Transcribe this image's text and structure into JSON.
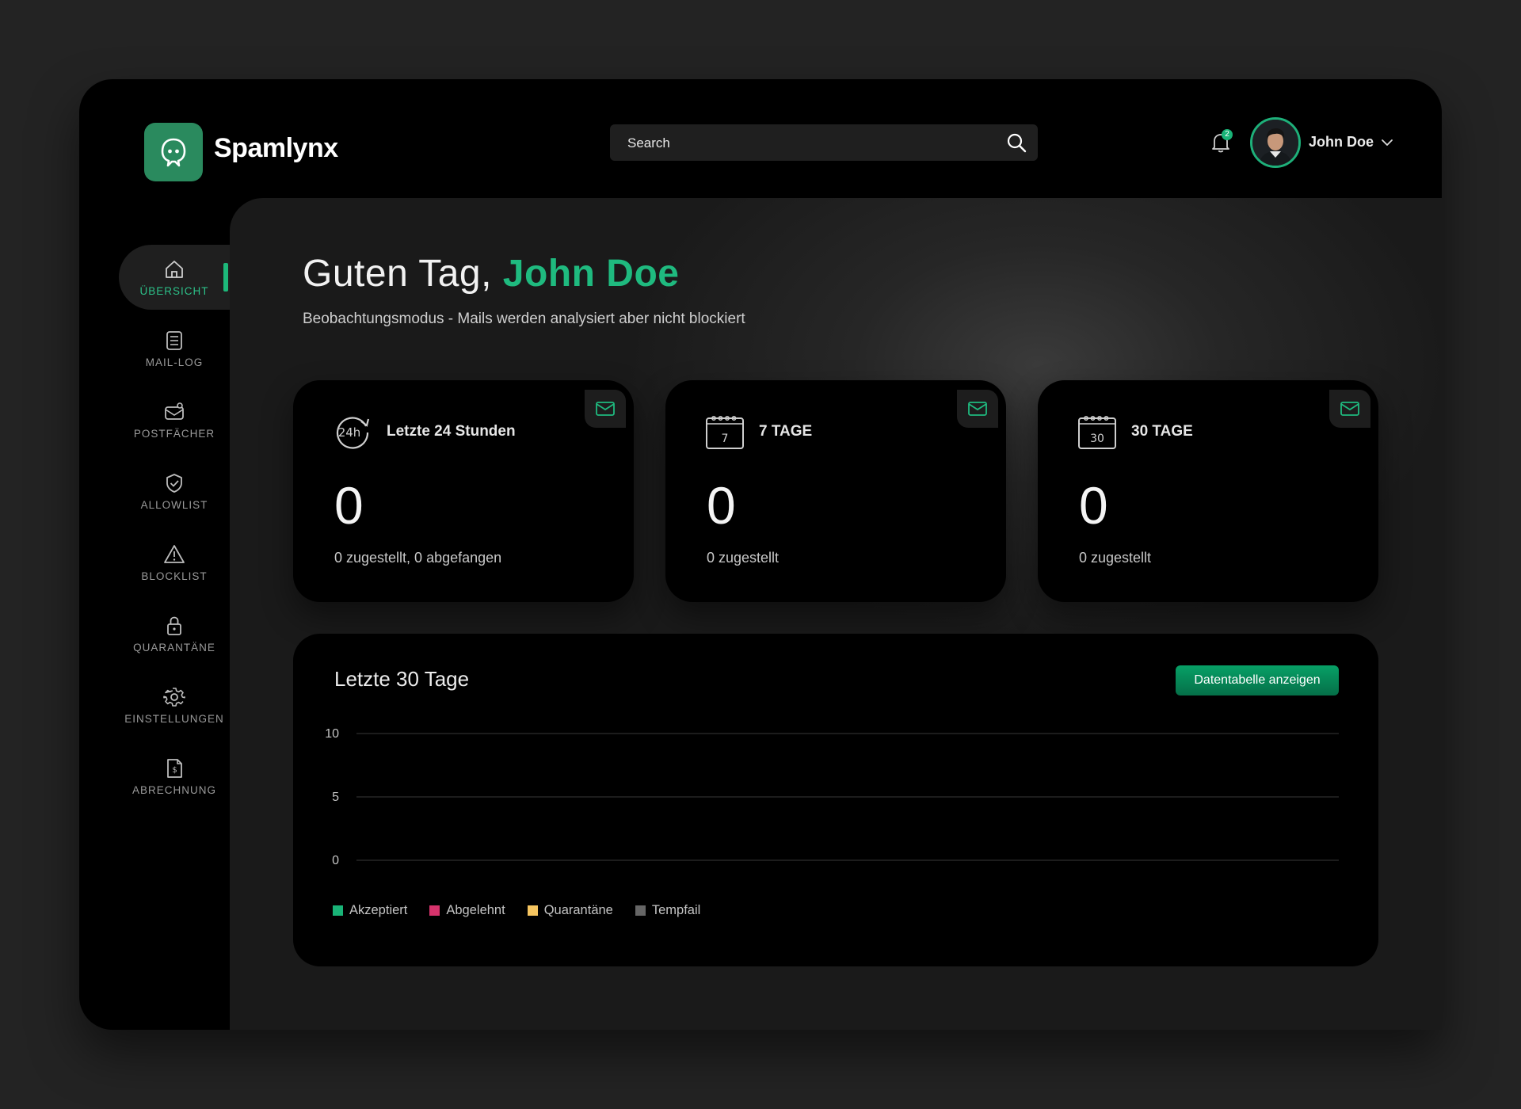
{
  "app": {
    "brand": "Spamlynx"
  },
  "header": {
    "search_placeholder": "Search",
    "notification_count": "2",
    "user_name": "John Doe"
  },
  "sidebar": {
    "items": [
      {
        "label": "ÜBERSICHT",
        "icon": "home-icon",
        "active": true
      },
      {
        "label": "MAIL-LOG",
        "icon": "log-icon"
      },
      {
        "label": "POSTFÄCHER",
        "icon": "mailbox-icon"
      },
      {
        "label": "ALLOWLIST",
        "icon": "shield-check-icon"
      },
      {
        "label": "BLOCKLIST",
        "icon": "warning-icon"
      },
      {
        "label": "QUARANTÄNE",
        "icon": "lock-icon"
      },
      {
        "label": "EINSTELLUNGEN",
        "icon": "gear-icon"
      },
      {
        "label": "ABRECHNUNG",
        "icon": "invoice-icon"
      }
    ]
  },
  "main": {
    "greeting_prefix": "Guten Tag, ",
    "greeting_name": "John Doe",
    "subtitle": "Beobachtungsmodus - Mails werden analysiert aber nicht blockiert",
    "cards": [
      {
        "icon": "24h-icon",
        "icon_text": "24h",
        "title": "Letzte 24 Stunden",
        "value": "0",
        "note": "0 zugestellt, 0 abgefangen"
      },
      {
        "icon": "calendar-icon",
        "icon_text": "7",
        "title": "7 TAGE",
        "value": "0",
        "note": "0 zugestellt"
      },
      {
        "icon": "calendar-icon",
        "icon_text": "30",
        "title": "30 TAGE",
        "value": "0",
        "note": "0 zugestellt"
      }
    ],
    "chart_section": {
      "title": "Letzte 30 Tage",
      "button_label": "Datentabelle anzeigen"
    }
  },
  "colors": {
    "accent": "#1fba7f",
    "background": "#232323",
    "panel": "#000000"
  },
  "chart_data": {
    "type": "bar",
    "title": "Letzte 30 Tage",
    "ylim": [
      0,
      10
    ],
    "y_ticks": [
      "10",
      "5",
      "0"
    ],
    "grid": true,
    "legend_position": "bottom-left",
    "series": [
      {
        "name": "Akzeptiert",
        "color": "#19b377",
        "values": []
      },
      {
        "name": "Abgelehnt",
        "color": "#d6336c",
        "values": []
      },
      {
        "name": "Quarantäne",
        "color": "#f6c560",
        "values": []
      },
      {
        "name": "Tempfail",
        "color": "#666666",
        "values": []
      }
    ]
  }
}
